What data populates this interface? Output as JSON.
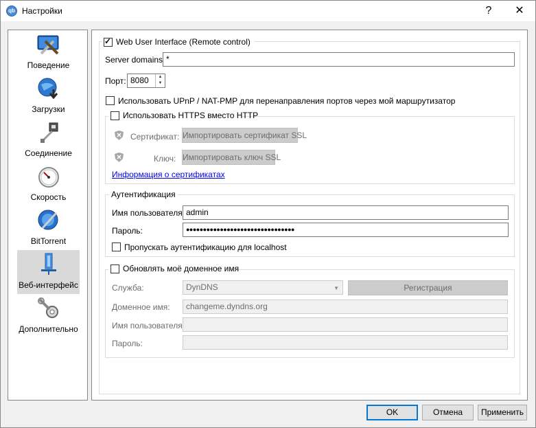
{
  "window": {
    "title": "Настройки",
    "help": "?",
    "close": "✕",
    "app_icon": "qBittorrent-icon"
  },
  "sidebar": {
    "items": [
      {
        "label": "Поведение",
        "icon": "behavior-icon"
      },
      {
        "label": "Загрузки",
        "icon": "downloads-icon"
      },
      {
        "label": "Соединение",
        "icon": "connection-icon"
      },
      {
        "label": "Скорость",
        "icon": "speed-icon"
      },
      {
        "label": "BitTorrent",
        "icon": "bittorrent-icon"
      },
      {
        "label": "Веб-интерфейс",
        "icon": "webui-icon"
      },
      {
        "label": "Дополнительно",
        "icon": "advanced-icon"
      }
    ],
    "selected": "Веб-интерфейс"
  },
  "webui": {
    "enable_label": "Web User Interface (Remote control)",
    "enabled": true,
    "server_domains_label": "Server domains:",
    "server_domains_value": "*",
    "port_label": "Порт:",
    "port_value": "8080",
    "upnp_label": "Использовать UPnP / NAT-PMP для перенаправления портов через мой маршрутизатор",
    "https": {
      "label": "Использовать HTTPS вместо HTTP",
      "cert_label": "Сертификат:",
      "cert_button": "Импортировать сертификат SSL",
      "key_label": "Ключ:",
      "key_button": "Импортировать ключ SSL",
      "info_link": "Информация о сертификатах"
    },
    "auth": {
      "title": "Аутентификация",
      "username_label": "Имя пользователя:",
      "username_value": "admin",
      "password_label": "Пароль:",
      "password_value": "●●●●●●●●●●●●●●●●●●●●●●●●●●●●●●●●",
      "bypass_localhost_label": "Пропускать аутентификацию для localhost"
    },
    "dyndns": {
      "label": "Обновлять моё доменное имя",
      "service_label": "Служба:",
      "service_value": "DynDNS",
      "register_button": "Регистрация",
      "domain_label": "Доменное имя:",
      "domain_value": "changeme.dyndns.org",
      "username_label": "Имя пользователя:",
      "password_label": "Пароль:"
    }
  },
  "footer": {
    "ok": "OK",
    "cancel": "Отмена",
    "apply": "Применить"
  }
}
